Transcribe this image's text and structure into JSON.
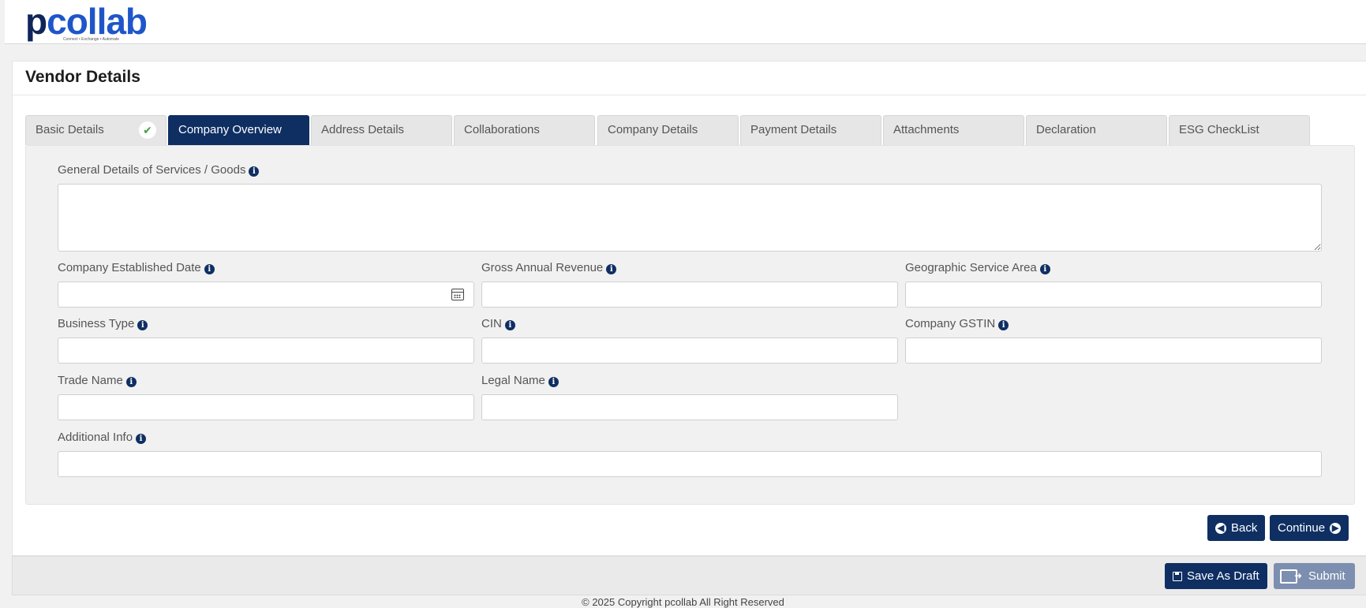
{
  "brand": {
    "logo_p": "p",
    "logo_rest": "collab",
    "tagline": "Connect • Exchange • Automate"
  },
  "page": {
    "title": "Vendor Details"
  },
  "tabs": [
    {
      "label": "Basic Details",
      "completed": true
    },
    {
      "label": "Company Overview",
      "active": true
    },
    {
      "label": "Address Details"
    },
    {
      "label": "Collaborations"
    },
    {
      "label": "Company Details"
    },
    {
      "label": "Payment Details"
    },
    {
      "label": "Attachments"
    },
    {
      "label": "Declaration"
    },
    {
      "label": "ESG CheckList"
    }
  ],
  "form": {
    "general_details": {
      "label": "General Details of Services / Goods",
      "value": ""
    },
    "established_date": {
      "label": "Company Established Date",
      "value": ""
    },
    "gross_revenue": {
      "label": "Gross Annual Revenue",
      "value": ""
    },
    "geo_area": {
      "label": "Geographic Service Area",
      "value": ""
    },
    "business_type": {
      "label": "Business Type",
      "value": ""
    },
    "cin": {
      "label": "CIN",
      "value": ""
    },
    "gstin": {
      "label": "Company GSTIN",
      "value": ""
    },
    "trade_name": {
      "label": "Trade Name",
      "value": ""
    },
    "legal_name": {
      "label": "Legal Name",
      "value": ""
    },
    "additional_info": {
      "label": "Additional Info",
      "value": ""
    }
  },
  "nav": {
    "back_label": "Back",
    "continue_label": "Continue"
  },
  "footer": {
    "save_draft_label": "Save As Draft",
    "submit_label": "Submit",
    "copyright": "© 2025 Copyright pcollab All Right Reserved"
  },
  "colors": {
    "primary": "#0f2f63",
    "brand_blue": "#1e56c9",
    "check_green": "#43a047",
    "disabled": "#7d8fb0"
  },
  "icons": {
    "info": "info-circle-icon",
    "calendar": "calendar-icon",
    "back": "arrow-circle-left-icon",
    "continue": "arrow-circle-right-icon",
    "save": "floppy-disk-icon",
    "submit": "submit-card-icon",
    "check": "check-circle-icon"
  }
}
